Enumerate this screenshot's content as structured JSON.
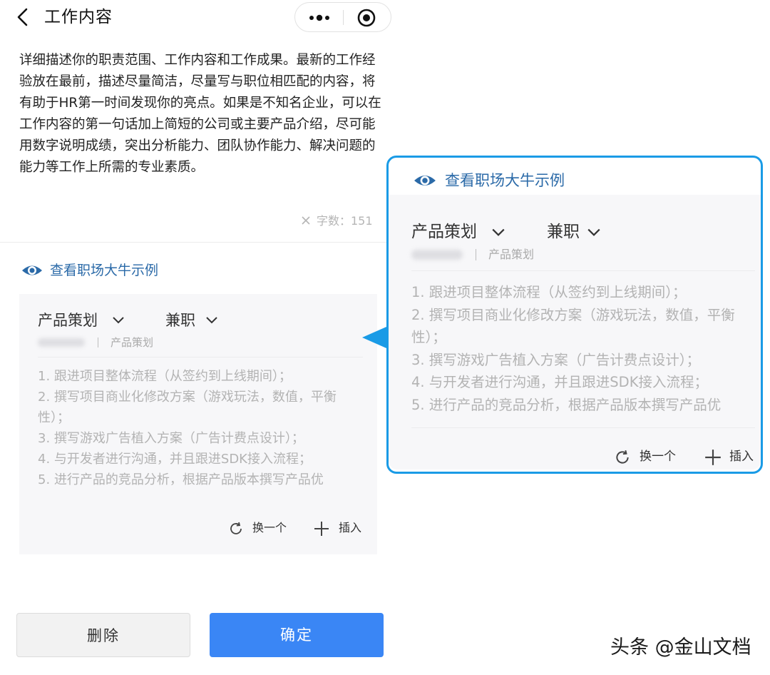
{
  "header": {
    "title": "工作内容"
  },
  "description": {
    "text": "详细描述你的职责范围、工作内容和工作成果。最新的工作经验放在最前，描述尽量简洁，尽量写与职位相匹配的内容，将有助于HR第一时间发现你的亮点。如果是不知名企业，可以在工作内容的第一句话加上简短的公司或主要产品介绍，尽可能用数字说明成绩，突出分析能力、团队协作能力、解决问题的能力等工作上所需的专业素质。",
    "word_count": "字数：151"
  },
  "example": {
    "link_label": "查看职场大牛示例",
    "role": "产品策划",
    "job_type": "兼职",
    "role_sub": "产品策划",
    "duties": [
      "1. 跟进项目整体流程（从签约到上线期间）；",
      "2. 撰写项目商业化修改方案（游戏玩法，数值，平衡性）；",
      "3. 撰写游戏广告植入方案（广告计费点设计）；",
      "4. 与开发者进行沟通，并且跟进SDK接入流程；",
      "5. 进行产品的竞品分析，根据产品版本撰写产品优"
    ],
    "refresh_label": "换一个",
    "insert_label": "插入"
  },
  "buttons": {
    "delete": "删除",
    "confirm": "确定"
  },
  "watermark": "头条 @金山文档",
  "colors": {
    "accent_blue": "#3a86f5",
    "link_blue": "#2b6aa8",
    "callout_blue": "#1a9be6"
  }
}
